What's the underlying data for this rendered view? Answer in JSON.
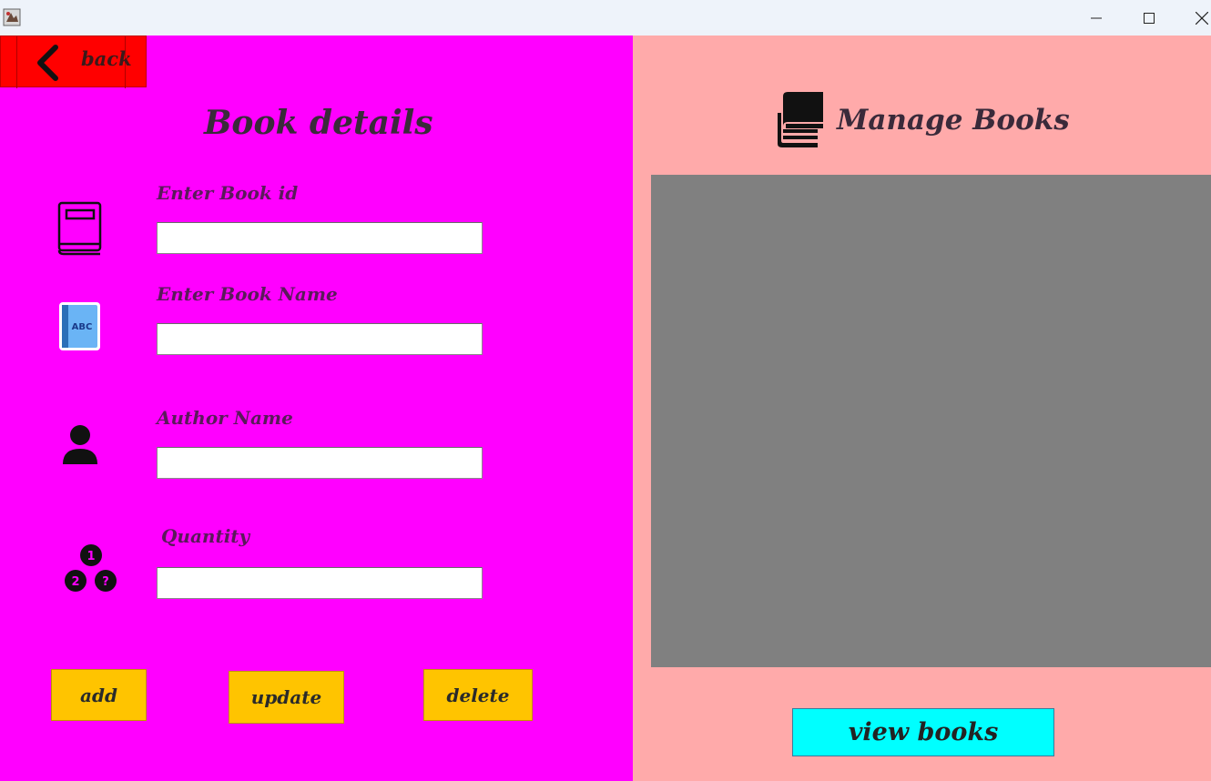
{
  "window": {
    "app_icon": "java-app-icon",
    "controls": [
      "minimize-icon",
      "maximize-icon",
      "close-icon"
    ]
  },
  "left": {
    "back_label": "back",
    "title": "Book details",
    "fields": [
      {
        "label": "Enter Book id",
        "value": "",
        "icon": "book-icon"
      },
      {
        "label": "Enter Book Name",
        "value": "",
        "icon": "abc-book-icon"
      },
      {
        "label": "Author Name",
        "value": "",
        "icon": "person-icon"
      },
      {
        "label": "Quantity",
        "value": "",
        "icon": "quantity-icon"
      }
    ],
    "buttons": {
      "add": "add",
      "update": "update",
      "delete": "delete"
    }
  },
  "right": {
    "title": "Manage Books",
    "title_icon": "books-stack-icon",
    "view_button": "view books"
  },
  "colors": {
    "left_bg": "#ff00ff",
    "right_bg": "#ffaaaa",
    "back_bg": "#ff0000",
    "action_bg": "#ffc400",
    "view_bg": "#00ffff",
    "table_bg": "#808080"
  }
}
